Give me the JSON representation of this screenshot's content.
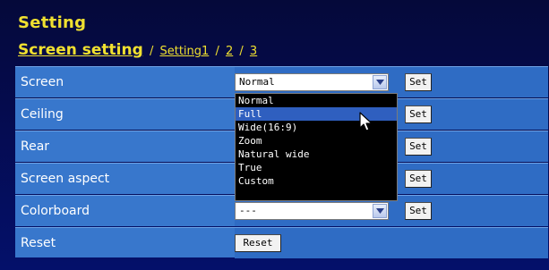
{
  "header": {
    "title": "Setting",
    "breadcrumb_current": "Screen setting",
    "breadcrumb_links": [
      "Setting1",
      "2",
      "3"
    ],
    "separator": "/"
  },
  "rows": [
    {
      "label": "Screen",
      "select_value": "Normal",
      "button": "Set"
    },
    {
      "label": "Ceiling",
      "button": "Set"
    },
    {
      "label": "Rear",
      "button": "Set"
    },
    {
      "label": "Screen aspect",
      "button": "Set"
    },
    {
      "label": "Colorboard",
      "select_value": "---",
      "button": "Set"
    },
    {
      "label": "Reset",
      "button": "Reset"
    }
  ],
  "dropdown": {
    "options": [
      "Normal",
      "Full",
      "Wide(16:9)",
      "Zoom",
      "Natural wide",
      "True",
      "Custom"
    ],
    "highlighted": "Full"
  },
  "colors": {
    "title": "#f0e030",
    "row_bg": "#3877cc",
    "panel_bg": "#050b4e",
    "highlight": "#2f5fbf"
  },
  "icons": {
    "select_arrow": "chevron-down-icon",
    "mouse_cursor": "mouse-pointer-icon"
  }
}
